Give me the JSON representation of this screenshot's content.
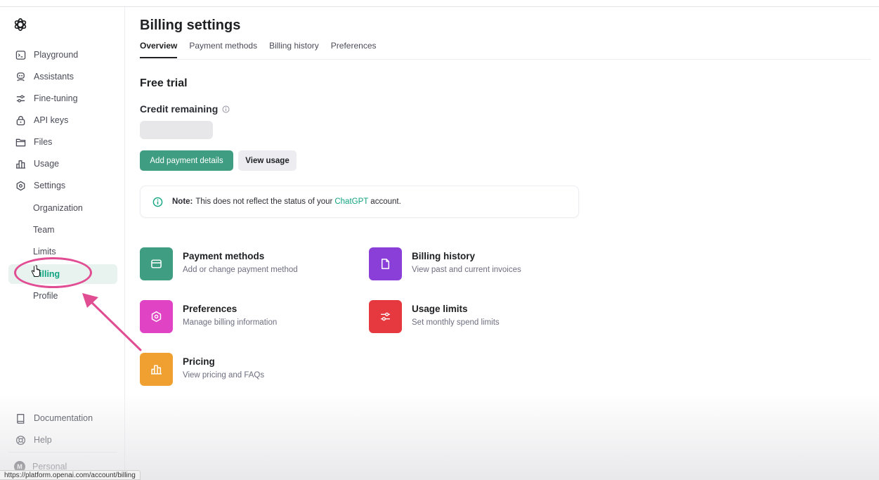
{
  "sidebar": {
    "logo_icon": "openai-logo-icon",
    "items": [
      {
        "label": "Playground",
        "icon": "terminal-icon"
      },
      {
        "label": "Assistants",
        "icon": "robot-icon"
      },
      {
        "label": "Fine-tuning",
        "icon": "sliders-icon"
      },
      {
        "label": "API keys",
        "icon": "lock-icon"
      },
      {
        "label": "Files",
        "icon": "folder-icon"
      },
      {
        "label": "Usage",
        "icon": "bar-chart-icon"
      },
      {
        "label": "Settings",
        "icon": "gear-icon"
      }
    ],
    "settings_sub": [
      {
        "label": "Organization"
      },
      {
        "label": "Team"
      },
      {
        "label": "Limits"
      },
      {
        "label": "Billing",
        "active": true
      },
      {
        "label": "Profile"
      }
    ],
    "bottom": [
      {
        "label": "Documentation",
        "icon": "book-icon"
      },
      {
        "label": "Help",
        "icon": "lifebuoy-icon"
      }
    ],
    "account": {
      "initial": "M",
      "label": "Personal"
    }
  },
  "header": {
    "title": "Billing settings",
    "tabs": [
      {
        "label": "Overview",
        "active": true
      },
      {
        "label": "Payment methods"
      },
      {
        "label": "Billing history"
      },
      {
        "label": "Preferences"
      }
    ]
  },
  "overview": {
    "section_title": "Free trial",
    "credit_label": "Credit remaining",
    "credit_value": "",
    "buttons": {
      "primary": "Add payment details",
      "secondary": "View usage"
    },
    "note": {
      "prefix": "Note:",
      "text_before": "This does not reflect the status of your",
      "link": "ChatGPT",
      "text_after": "account."
    }
  },
  "cards": [
    {
      "title": "Payment methods",
      "desc": "Add or change payment method",
      "color": "#3f9d82",
      "icon": "credit-card-icon"
    },
    {
      "title": "Billing history",
      "desc": "View past and current invoices",
      "color": "#8b3fd9",
      "icon": "document-icon"
    },
    {
      "title": "Preferences",
      "desc": "Manage billing information",
      "color": "#e043c4",
      "icon": "gear-icon"
    },
    {
      "title": "Usage limits",
      "desc": "Set monthly spend limits",
      "color": "#e5393f",
      "icon": "sliders-icon"
    },
    {
      "title": "Pricing",
      "desc": "View pricing and FAQs",
      "color": "#f0a030",
      "icon": "bar-chart-icon"
    }
  ],
  "status_url": "https://platform.openai.com/account/billing",
  "colors": {
    "accent": "#10a37f",
    "annotation": "#e14d92"
  }
}
